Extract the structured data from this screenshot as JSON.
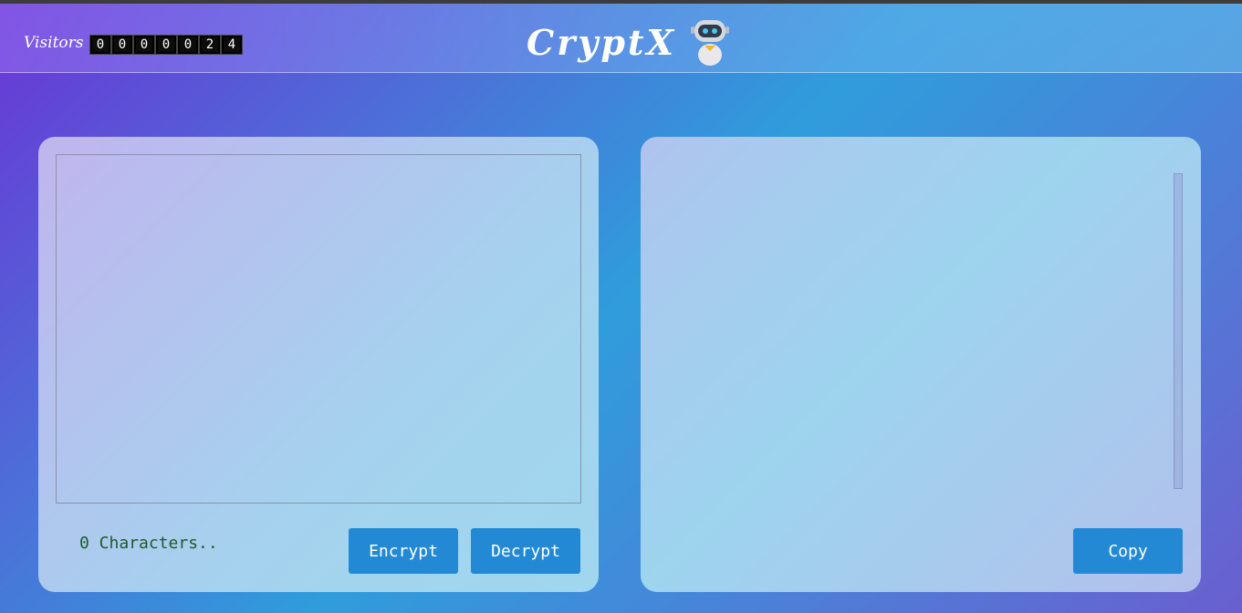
{
  "header": {
    "visitors_label": "Visitors",
    "visitor_digits": [
      "0",
      "0",
      "0",
      "0",
      "0",
      "2",
      "4"
    ],
    "brand_title": "CryptX",
    "brand_icon": "robot-icon"
  },
  "editor": {
    "input_value": "",
    "char_count": "0 Characters..",
    "encrypt_label": "Encrypt",
    "decrypt_label": "Decrypt"
  },
  "output": {
    "value": "",
    "copy_label": "Copy"
  },
  "colors": {
    "button": "#2389d4",
    "char_count_text": "#1f5b28"
  }
}
